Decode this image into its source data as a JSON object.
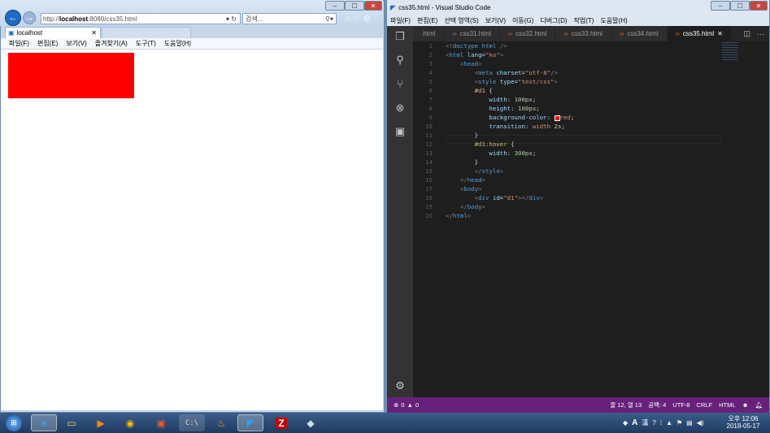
{
  "browser": {
    "url_prefix": "http://",
    "url_host": "localhost",
    "url_rest": ":8080/css35.html",
    "search_placeholder": "검색...",
    "tab_title": "localhost",
    "menu": [
      "파일(F)",
      "편집(E)",
      "보기(V)",
      "즐겨찾기(A)",
      "도구(T)",
      "도움말(H)"
    ],
    "red_box_color": "#ff0000"
  },
  "vscode": {
    "title": "css35.html - Visual Studio Code",
    "menu": [
      "파일(F)",
      "편집(E)",
      "선택 영역(S)",
      "보기(V)",
      "이동(G)",
      "디버그(D)",
      "작업(T)",
      "도움말(H)"
    ],
    "tabs": [
      ".html",
      "css31.html",
      "css32.html",
      "css33.html",
      "css34.html",
      "css35.html"
    ],
    "active_tab_index": 5,
    "line_numbers": [
      "1",
      "2",
      "3",
      "4",
      "5",
      "6",
      "7",
      "8",
      "9",
      "10",
      "11",
      "12",
      "13",
      "14",
      "15",
      "16",
      "17",
      "18",
      "19",
      "20"
    ],
    "status": {
      "errors": "0",
      "warnings": "0",
      "position": "줄 12, 열 13",
      "spaces": "공백: 4",
      "encoding": "UTF-8",
      "eol": "CRLF",
      "language": "HTML"
    },
    "accent": "#68217a"
  },
  "taskbar": {
    "clock_time": "오후 12:06",
    "clock_date": "2018-05-17",
    "tray_lang": "A",
    "tray_ime": "漢"
  }
}
